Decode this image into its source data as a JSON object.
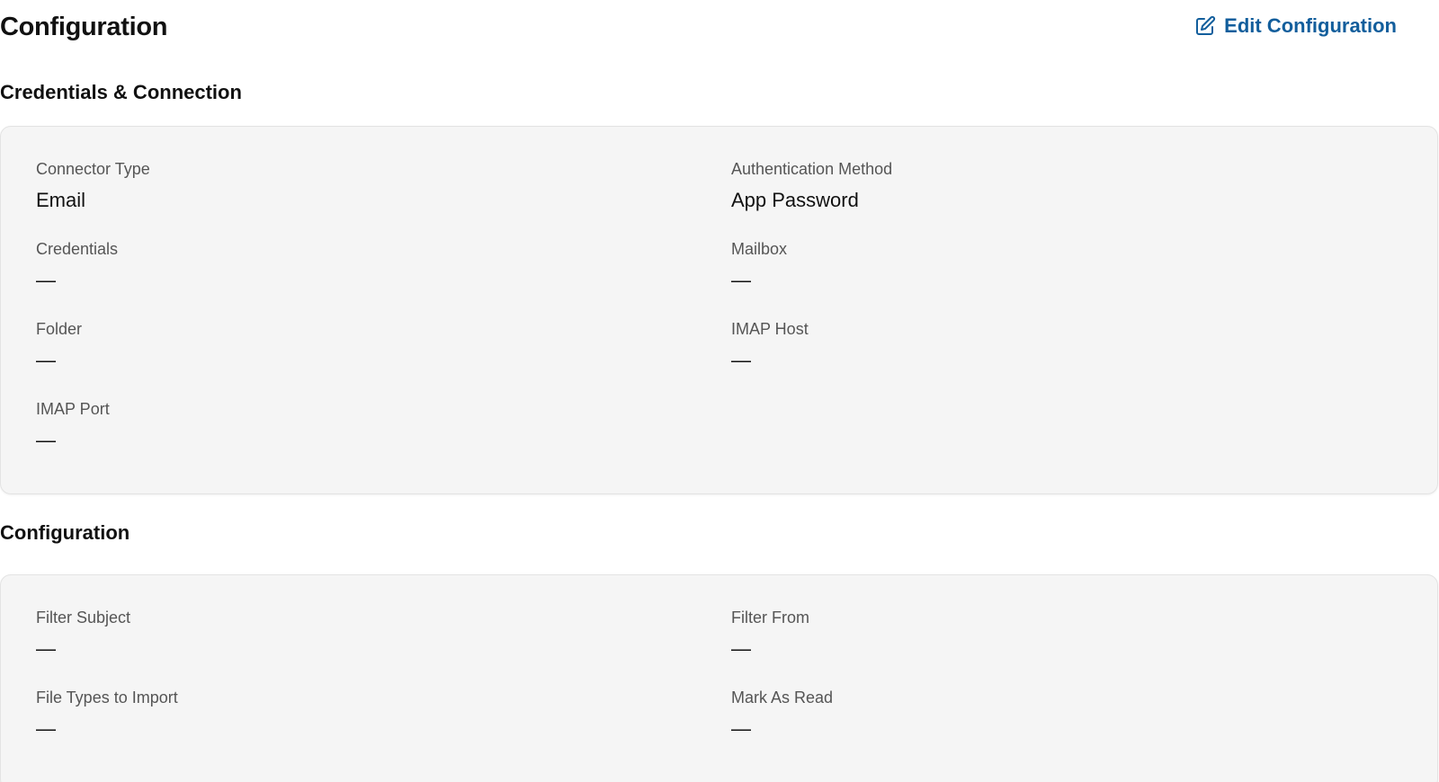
{
  "header": {
    "title": "Configuration",
    "edit_label": "Edit Configuration",
    "edit_icon": "edit-icon",
    "accent_color": "#125e9c"
  },
  "credentials_section": {
    "title": "Credentials & Connection",
    "fields": {
      "connector_type": {
        "label": "Connector Type",
        "value": "Email"
      },
      "authentication_method": {
        "label": "Authentication Method",
        "value": "App Password"
      },
      "credentials": {
        "label": "Credentials",
        "value": "—"
      },
      "mailbox": {
        "label": "Mailbox",
        "value": "—"
      },
      "folder": {
        "label": "Folder",
        "value": "—"
      },
      "imap_host": {
        "label": "IMAP Host",
        "value": "—"
      },
      "imap_port": {
        "label": "IMAP Port",
        "value": "—"
      }
    }
  },
  "configuration_section": {
    "title": "Configuration",
    "fields": {
      "filter_subject": {
        "label": "Filter Subject",
        "value": "—"
      },
      "filter_from": {
        "label": "Filter From",
        "value": "—"
      },
      "file_types": {
        "label": "File Types to Import",
        "value": "—"
      },
      "mark_as_read": {
        "label": "Mark As Read",
        "value": "—"
      }
    }
  }
}
